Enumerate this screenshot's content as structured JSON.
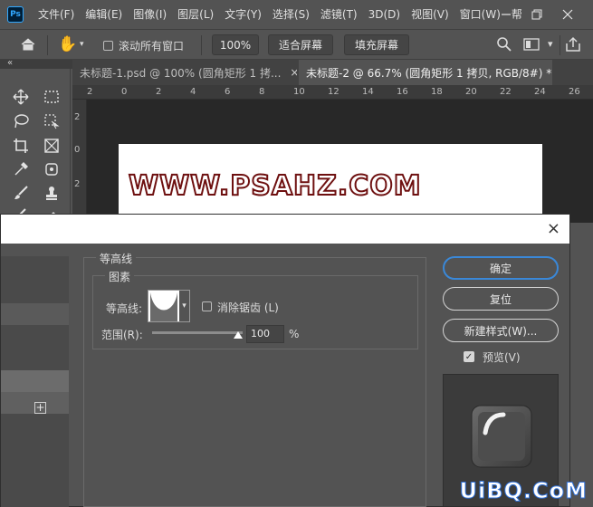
{
  "app": {
    "logo": "Ps"
  },
  "menu": [
    "文件(F)",
    "编辑(E)",
    "图像(I)",
    "图层(L)",
    "文字(Y)",
    "选择(S)",
    "滤镜(T)",
    "3D(D)",
    "视图(V)",
    "窗口(W)",
    "帮"
  ],
  "options": {
    "scroll_all_label": "滚动所有窗口",
    "zoom_value": "100%",
    "fit_screen_label": "适合屏幕",
    "fill_screen_label": "填充屏幕"
  },
  "tabs": [
    {
      "label": "未标题-1.psd @ 100% (圆角矩形 1 拷...",
      "close": "×",
      "active": false
    },
    {
      "label": "未标题-2 @ 66.7% (圆角矩形 1 拷贝, RGB/8#) *",
      "close": "×",
      "active": true
    }
  ],
  "ruler": {
    "top": [
      "2",
      "0",
      "2",
      "4",
      "6",
      "8",
      "10",
      "12",
      "14",
      "16",
      "18",
      "20",
      "22",
      "24",
      "26"
    ],
    "left": [
      "2",
      "0",
      "2"
    ]
  },
  "canvas": {
    "text": "WWW.PSAHZ.COM"
  },
  "dialog": {
    "close_icon": "×",
    "section_title": "等高线",
    "group_title": "图素",
    "contour_label": "等高线:",
    "antialias_label": "消除锯齿 (L)",
    "range_label": "范围(R):",
    "range_value": "100",
    "range_unit": "%",
    "range_fraction": 1.0,
    "add_icon": "+",
    "buttons": {
      "ok": "确定",
      "reset": "复位",
      "new_style": "新建样式(W)...",
      "preview": "预览(V)"
    },
    "preview_checked": true
  },
  "watermark": "UiBQ.CoM",
  "colors": {
    "accent": "#3a88d8",
    "text_stroke": "#6e1010",
    "watermark_stroke": "#2e6fd6"
  }
}
